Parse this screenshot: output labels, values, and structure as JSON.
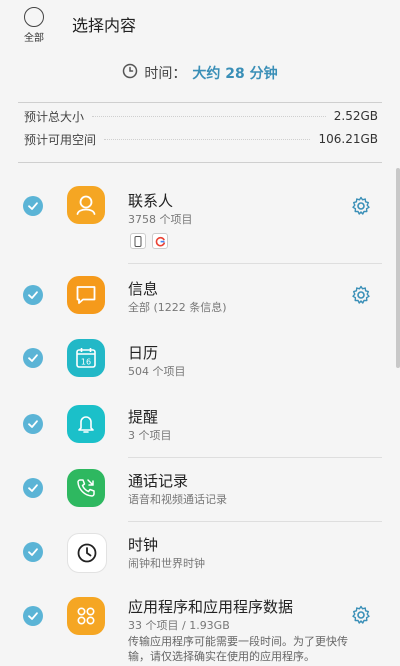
{
  "header": {
    "select_all_label": "全部",
    "title": "选择内容"
  },
  "time": {
    "label": "时间：",
    "value": "大约 28 分钟"
  },
  "stats": {
    "total_size_label": "预计总大小",
    "total_size_value": "2.52GB",
    "available_label": "预计可用空间",
    "available_value": "106.21GB"
  },
  "items": [
    {
      "name": "联系人",
      "sub": "3758 个项目",
      "icon": "contacts-icon",
      "color": "#f5a623",
      "has_settings": true
    },
    {
      "name": "信息",
      "sub": "全部 (1222 条信息)",
      "icon": "messages-icon",
      "color": "#f59a1b",
      "has_settings": true
    },
    {
      "name": "日历",
      "sub": "504 个项目",
      "icon": "calendar-icon",
      "color": "#22b8c7",
      "has_settings": false
    },
    {
      "name": "提醒",
      "sub": "3 个项目",
      "icon": "reminder-icon",
      "color": "#1bc0c9",
      "has_settings": false
    },
    {
      "name": "通话记录",
      "sub": "语音和视频通话记录",
      "icon": "call-log-icon",
      "color": "#2eb860",
      "has_settings": false
    },
    {
      "name": "时钟",
      "sub": "闹钟和世界时钟",
      "icon": "clock-icon",
      "color": "#ffffff",
      "has_settings": false
    },
    {
      "name": "应用程序和应用程序数据",
      "sub": "33 个项目 / 1.93GB",
      "icon": "apps-icon",
      "color": "#f5a623",
      "has_settings": true,
      "extra_line1": "传输应用程序可能需要一段时间。为了更快传",
      "extra_line2": "输，请仅选择确实在使用的应用程序。"
    }
  ]
}
